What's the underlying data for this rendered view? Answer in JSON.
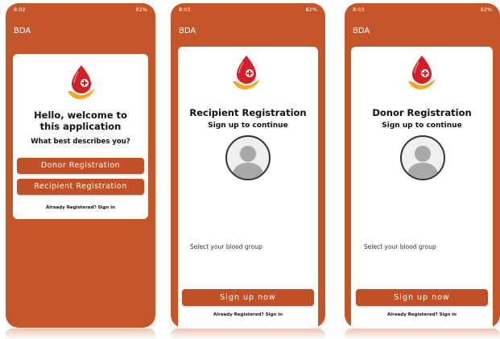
{
  "status": {
    "left_times": [
      "8:02",
      "8:03",
      "8:03"
    ],
    "right_text": [
      "82%",
      "82%",
      "82%"
    ]
  },
  "app": {
    "title": "BDA"
  },
  "screen1": {
    "welcome_title": "Hello, welcome to this application",
    "question": "What best describes you?",
    "donor_button": "Donor Registration",
    "recipient_button": "Recipient Registration",
    "signin_link": "Already Registered? Sign in"
  },
  "screen2": {
    "title": "Recipient Registration",
    "subtitle": "Sign up to continue",
    "blood_label": "Select your blood group",
    "signup_button": "Sign up now",
    "signin_link": "Already Registered? Sign in"
  },
  "screen3": {
    "title": "Donor Registration",
    "subtitle": "Sign up to continue",
    "blood_label": "Select your blood group",
    "signup_button": "Sign up now",
    "signin_link": "Already Registered? Sign in"
  },
  "colors": {
    "primary": "#c4562a",
    "button": "#c25128",
    "drop": "#d2202a",
    "hand": "#f4a623"
  }
}
